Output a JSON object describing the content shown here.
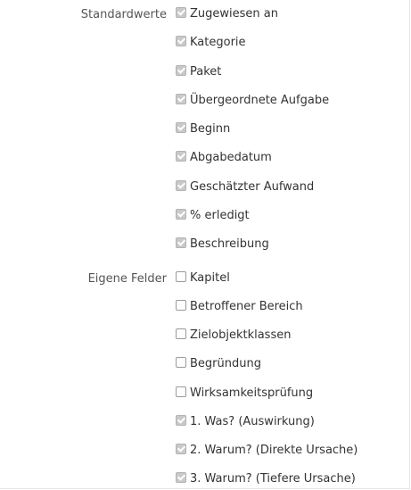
{
  "standard": {
    "label": "Standardwerte",
    "items": [
      {
        "label": "Zugewiesen an",
        "checked": true
      },
      {
        "label": "Kategorie",
        "checked": true
      },
      {
        "label": "Paket",
        "checked": true
      },
      {
        "label": "Übergeordnete Aufgabe",
        "checked": true
      },
      {
        "label": "Beginn",
        "checked": true
      },
      {
        "label": "Abgabedatum",
        "checked": true
      },
      {
        "label": "Geschätzter Aufwand",
        "checked": true
      },
      {
        "label": "% erledigt",
        "checked": true
      },
      {
        "label": "Beschreibung",
        "checked": true
      }
    ]
  },
  "custom": {
    "label": "Eigene Felder",
    "items": [
      {
        "label": "Kapitel",
        "checked": false
      },
      {
        "label": "Betroffener Bereich",
        "checked": false
      },
      {
        "label": "Zielobjektklassen",
        "checked": false
      },
      {
        "label": "Begründung",
        "checked": false
      },
      {
        "label": "Wirksamkeitsprüfung",
        "checked": false
      },
      {
        "label": "1. Was? (Auswirkung)",
        "checked": true
      },
      {
        "label": "2. Warum? (Direkte Ursache)",
        "checked": true
      },
      {
        "label": "3. Warum? (Tiefere Ursache)",
        "checked": true
      }
    ]
  }
}
